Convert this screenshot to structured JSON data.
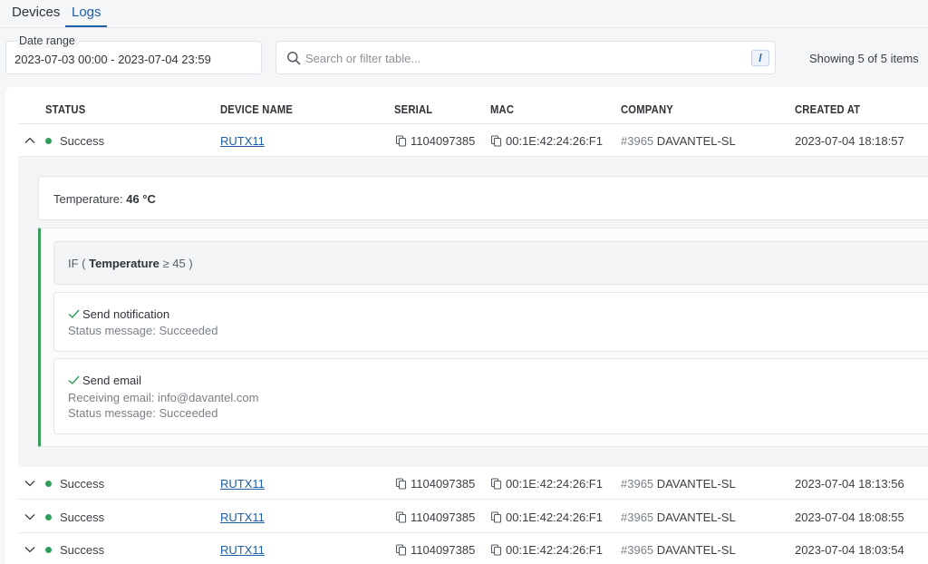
{
  "tabs": [
    {
      "label": "Devices",
      "active": false
    },
    {
      "label": "Logs",
      "active": true
    }
  ],
  "filters": {
    "date_label": "Date range",
    "date_value": "2023-07-03 00:00 - 2023-07-04 23:59",
    "search_placeholder": "Search or filter table...",
    "search_value": "",
    "shortcut_key": "/",
    "showing": "Showing 5 of 5 items"
  },
  "table": {
    "columns": [
      "STATUS",
      "DEVICE NAME",
      "SERIAL",
      "MAC",
      "COMPANY",
      "CREATED AT"
    ],
    "rows": [
      {
        "status": "Success",
        "device": "RUTX11",
        "serial": "1104097385",
        "mac": "00:1E:42:24:26:F1",
        "company_id": "#3965",
        "company": "DAVANTEL-SL",
        "created": "2023-07-04 18:18:57",
        "expanded": true
      },
      {
        "status": "Success",
        "device": "RUTX11",
        "serial": "1104097385",
        "mac": "00:1E:42:24:26:F1",
        "company_id": "#3965",
        "company": "DAVANTEL-SL",
        "created": "2023-07-04 18:13:56",
        "expanded": false
      },
      {
        "status": "Success",
        "device": "RUTX11",
        "serial": "1104097385",
        "mac": "00:1E:42:24:26:F1",
        "company_id": "#3965",
        "company": "DAVANTEL-SL",
        "created": "2023-07-04 18:08:55",
        "expanded": false
      },
      {
        "status": "Success",
        "device": "RUTX11",
        "serial": "1104097385",
        "mac": "00:1E:42:24:26:F1",
        "company_id": "#3965",
        "company": "DAVANTEL-SL",
        "created": "2023-07-04 18:03:54",
        "expanded": false
      }
    ]
  },
  "detail": {
    "temperature_label": "Temperature:",
    "temperature_value": "46 °C",
    "if_prefix": "IF (",
    "if_field": "Temperature",
    "if_condition": "≥ 45 )",
    "actions": [
      {
        "title": "Send notification",
        "lines": [
          "Status message: Succeeded"
        ]
      },
      {
        "title": "Send email",
        "lines": [
          "Receiving email: info@davantel.com",
          "Status message: Succeeded"
        ]
      }
    ]
  },
  "colors": {
    "accent": "#1f5ea8",
    "success": "#2f9e5a"
  }
}
